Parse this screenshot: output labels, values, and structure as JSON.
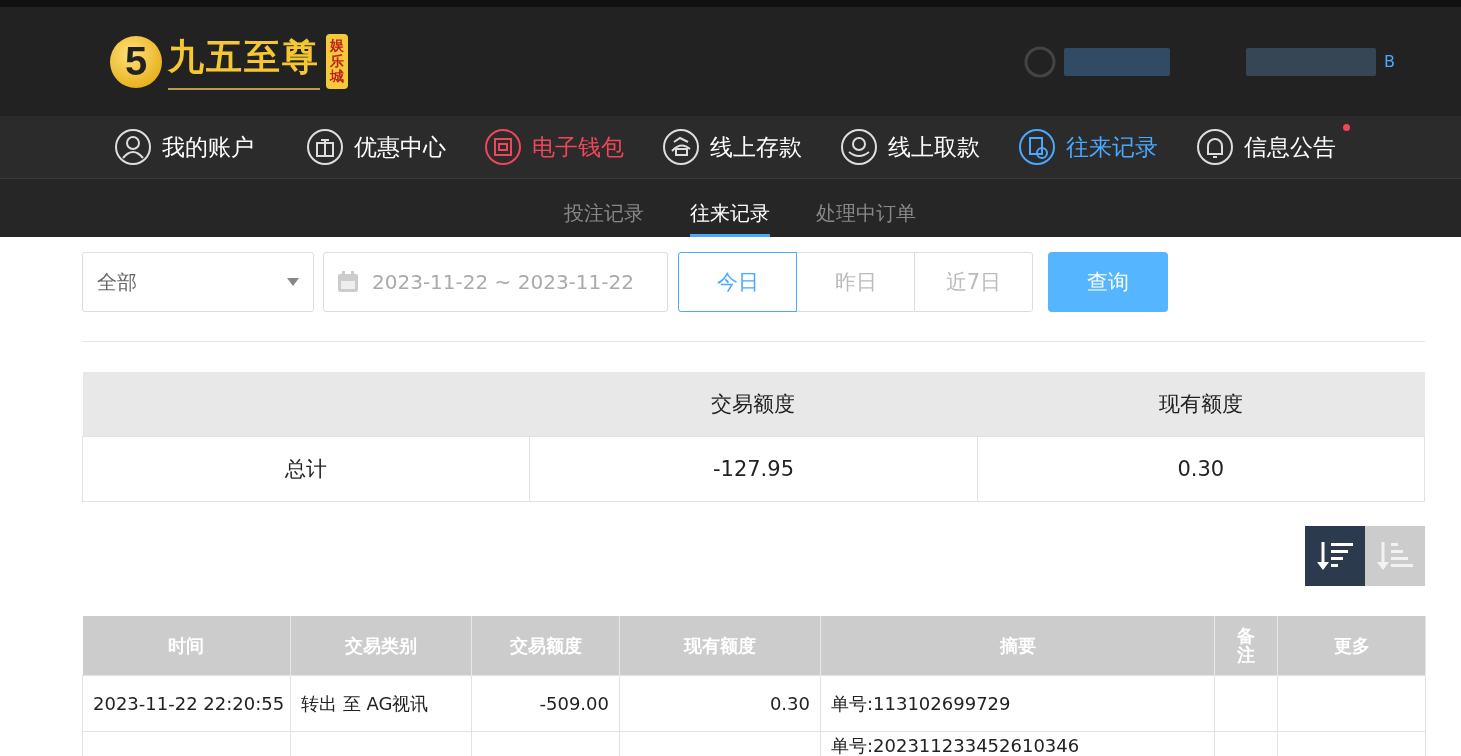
{
  "logo": {
    "mark": "5",
    "name": "九五至尊",
    "badge": "娱乐城"
  },
  "user": {
    "suffix": "B"
  },
  "nav": [
    {
      "label": "我的账户",
      "kind": "user",
      "selected": false,
      "highlighted": false,
      "badge": false
    },
    {
      "label": "优惠中心",
      "kind": "gift",
      "selected": false,
      "highlighted": false,
      "badge": false
    },
    {
      "label": "电子钱包",
      "kind": "wallet",
      "selected": false,
      "highlighted": true,
      "badge": false
    },
    {
      "label": "线上存款",
      "kind": "deposit",
      "selected": false,
      "highlighted": false,
      "badge": false
    },
    {
      "label": "线上取款",
      "kind": "withdraw",
      "selected": false,
      "highlighted": false,
      "badge": false
    },
    {
      "label": "往来记录",
      "kind": "record",
      "selected": true,
      "highlighted": false,
      "badge": false
    },
    {
      "label": "信息公告",
      "kind": "bell",
      "selected": false,
      "highlighted": false,
      "badge": true
    }
  ],
  "subnav": [
    {
      "label": "投注记录",
      "selected": false
    },
    {
      "label": "往来记录",
      "selected": true
    },
    {
      "label": "处理中订单",
      "selected": false
    }
  ],
  "filters": {
    "type": "全部",
    "date_range": "2023-11-22 ~ 2023-11-22",
    "periods": [
      {
        "label": "今日",
        "selected": true
      },
      {
        "label": "昨日",
        "selected": false
      },
      {
        "label": "近7日",
        "selected": false
      }
    ],
    "query": "查询"
  },
  "summary": {
    "columns": [
      "",
      "交易额度",
      "现有额度"
    ],
    "rows": [
      [
        "总计",
        "-127.95",
        "0.30"
      ]
    ]
  },
  "sort": [
    {
      "kind": "desc",
      "selected": true
    },
    {
      "kind": "asc",
      "selected": false
    }
  ],
  "table": {
    "columns": [
      "时间",
      "交易类别",
      "交易额度",
      "现有额度",
      "摘要",
      "备注",
      "更多"
    ],
    "rows": [
      [
        "2023-11-22 22:20:55",
        "转出 至 AG视讯",
        "-509.00",
        "0.30",
        "单号:113102699729",
        "",
        ""
      ],
      [
        "",
        "",
        "",
        "",
        "单号:202311233452610346",
        "",
        ""
      ]
    ]
  }
}
